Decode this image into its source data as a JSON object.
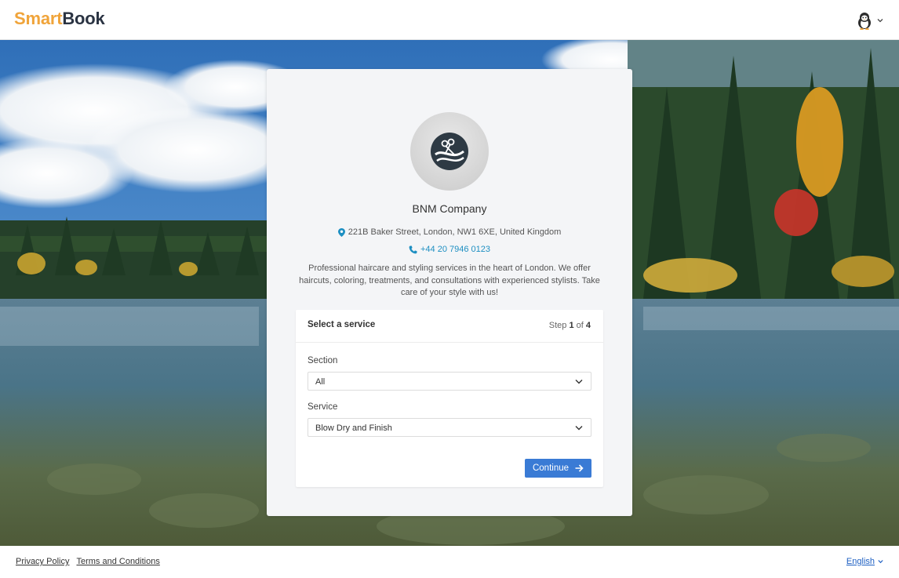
{
  "header": {
    "logo_part1": "Smart",
    "logo_part2": "Book",
    "user_icon": "user-avatar-icon",
    "user_menu_caret": "chevron-down-icon"
  },
  "company": {
    "name": "BNM Company",
    "address": "221B Baker Street, London, NW1 6XE, United Kingdom",
    "phone": "+44 20 7946 0123",
    "description": "Professional haircare and styling services in the heart of London. We offer haircuts, coloring, treatments, and consultations with experienced stylists. Take care of your style with us!",
    "logo_icon": "scissors-comb-icon"
  },
  "booking": {
    "title": "Select a service",
    "step_prefix": "Step",
    "step_current": "1",
    "step_of": "of",
    "step_total": "4",
    "section_label": "Section",
    "section_value": "All",
    "service_label": "Service",
    "service_value": "Blow Dry and Finish",
    "continue_label": "Continue"
  },
  "footer": {
    "privacy": "Privacy Policy",
    "terms": "Terms and Conditions",
    "language": "English"
  },
  "colors": {
    "accent": "#3a7bd5",
    "logo_orange": "#f0a43a",
    "link_blue": "#1d8fc2"
  }
}
